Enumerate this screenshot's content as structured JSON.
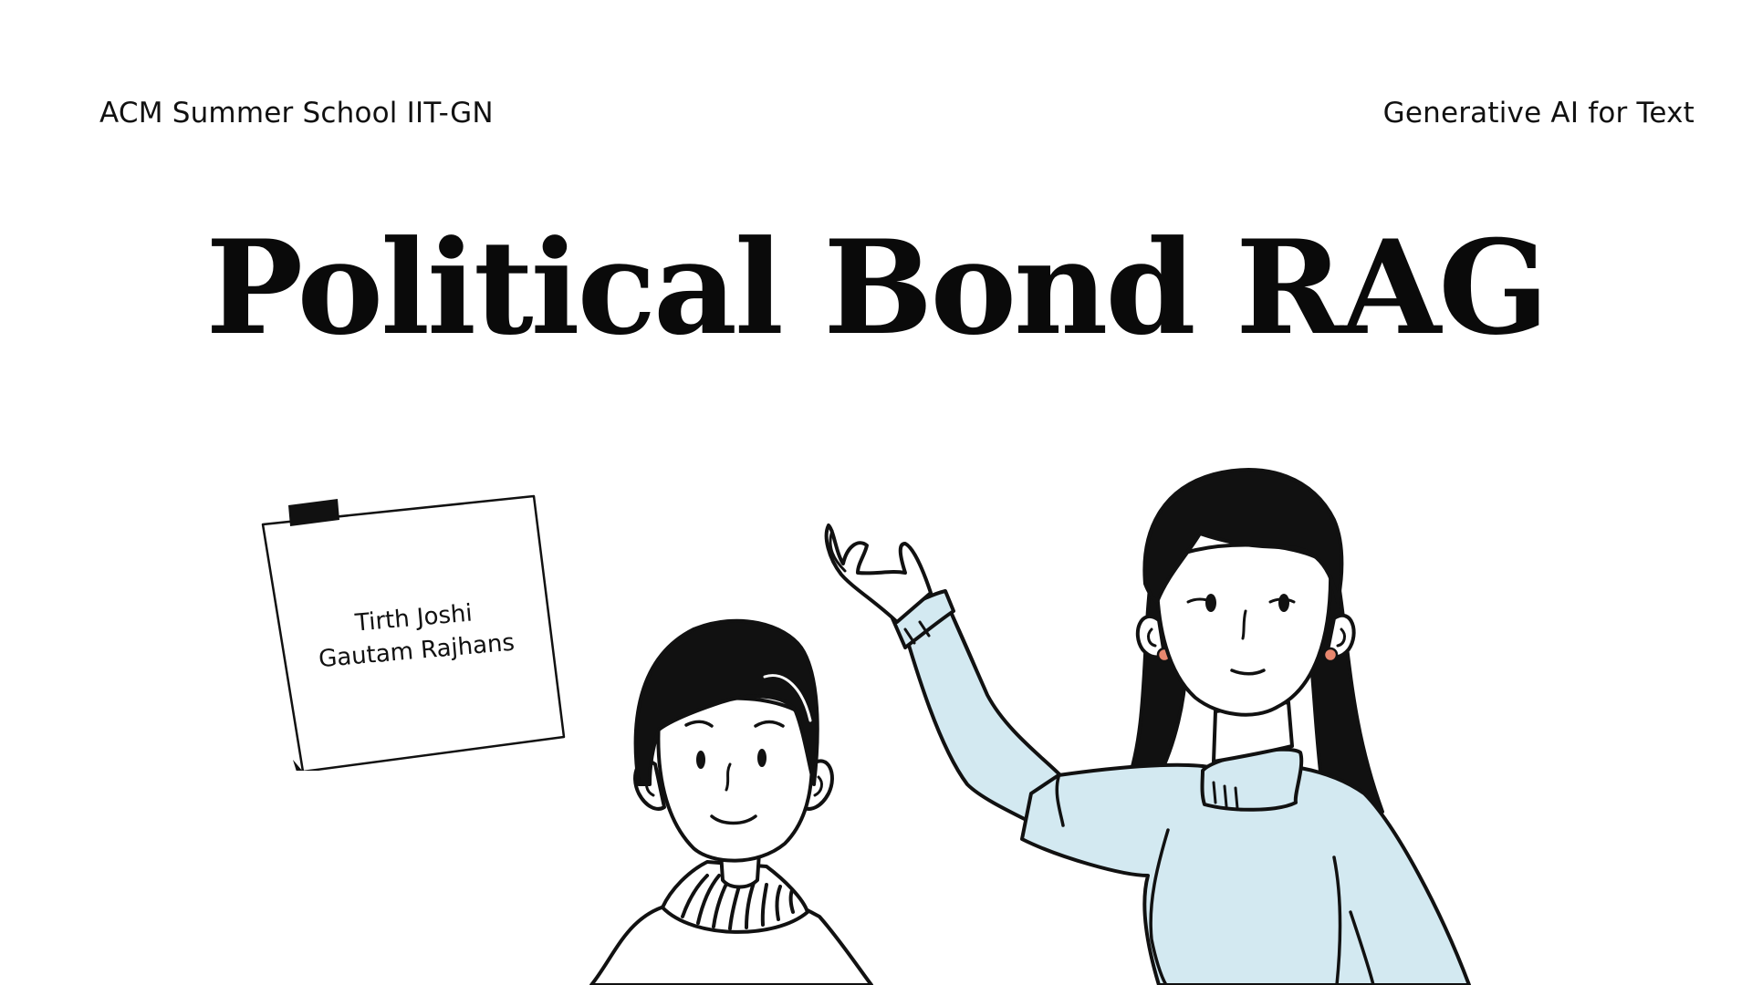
{
  "header": {
    "left": "ACM Summer School IIT-GN",
    "right": "Generative AI for Text"
  },
  "title": "Political Bond RAG",
  "note": {
    "authors": [
      "Tirth Joshi",
      "Gautam Rajhans"
    ]
  },
  "colors": {
    "background": "#ffffff",
    "text": "#111111",
    "sweater": "#d3e9f1",
    "earring": "#e8876e"
  },
  "icons": {
    "note": "sticky-note-icon",
    "illustration": "two-people-presenting-illustration"
  }
}
